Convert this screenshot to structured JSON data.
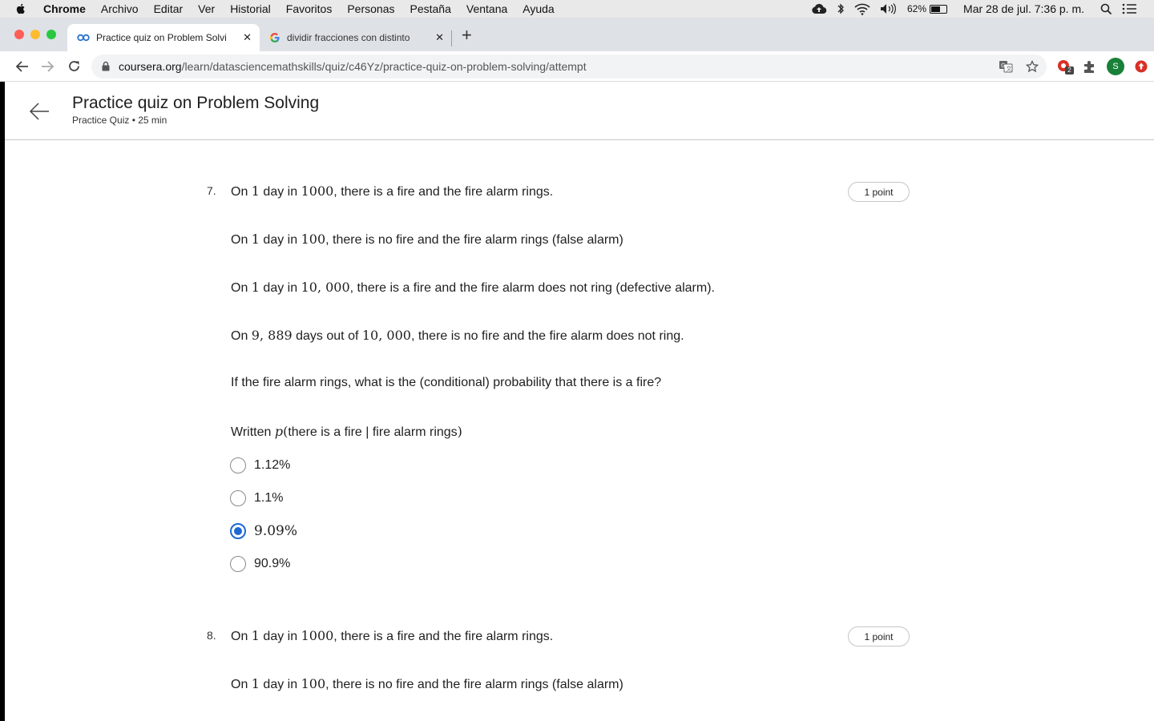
{
  "menubar": {
    "items": [
      "Chrome",
      "Archivo",
      "Editar",
      "Ver",
      "Historial",
      "Favoritos",
      "Personas",
      "Pestaña",
      "Ventana",
      "Ayuda"
    ],
    "battery_percent": "62%",
    "battery_level": 0.62,
    "datetime": "Mar 28 de jul.  7:36 p. m."
  },
  "tabs": [
    {
      "title": "Practice quiz on Problem Solvi",
      "icon": "coursera-icon",
      "active": true
    },
    {
      "title": "dividir fracciones con distinto",
      "icon": "google-icon",
      "active": false
    }
  ],
  "toolbar": {
    "url_host": "coursera.org",
    "url_path": "/learn/datasciencemathskills/quiz/c46Yz/practice-quiz-on-problem-solving/attempt",
    "extension_badge": "2",
    "profile_initial": "S"
  },
  "header": {
    "title": "Practice quiz on Problem Solving",
    "subtitle": "Practice Quiz • 25 min"
  },
  "questions": [
    {
      "number": "7.",
      "points": "1 point",
      "lines": [
        {
          "a": "On ",
          "m1": "1",
          "b": " day in ",
          "m2": "1000",
          "c": ", there is a fire and the fire alarm rings."
        },
        {
          "a": "On ",
          "m1": "1",
          "b": " day in ",
          "m2": "100",
          "c": ", there is no fire and the fire alarm rings (false alarm)"
        },
        {
          "a": "On ",
          "m1": "1",
          "b": " day in ",
          "m2": "10, 000",
          "c": ", there is a fire and the fire alarm does not ring (defective alarm)."
        },
        {
          "a": "On ",
          "m1": "9, 889",
          "b": " days out of ",
          "m2": "10, 000",
          "c": ", there is no fire and the fire alarm does not ring."
        }
      ],
      "question": "If the fire alarm rings, what is the (conditional) probability that there is a fire?",
      "written": {
        "prefix": "Written ",
        "p": "p",
        "open": "(",
        "body": "there is a fire | fire alarm rings",
        "close": ")"
      },
      "options": [
        "1.12%",
        "1.1%",
        "9.09%",
        "90.9%"
      ],
      "selected_index": 2
    },
    {
      "number": "8.",
      "points": "1 point",
      "lines": [
        {
          "a": "On ",
          "m1": "1",
          "b": " day in ",
          "m2": "1000",
          "c": ", there is a fire and the fire alarm rings."
        },
        {
          "a": "On ",
          "m1": "1",
          "b": " day in ",
          "m2": "100",
          "c": ", there is no fire and the fire alarm rings (false alarm)"
        }
      ]
    }
  ],
  "colors": {
    "accent": "#1e68d6",
    "close_red": "#ff5f57",
    "minimize_yellow": "#febc2e",
    "zoom_green": "#28c840",
    "profile_green": "#188038"
  }
}
